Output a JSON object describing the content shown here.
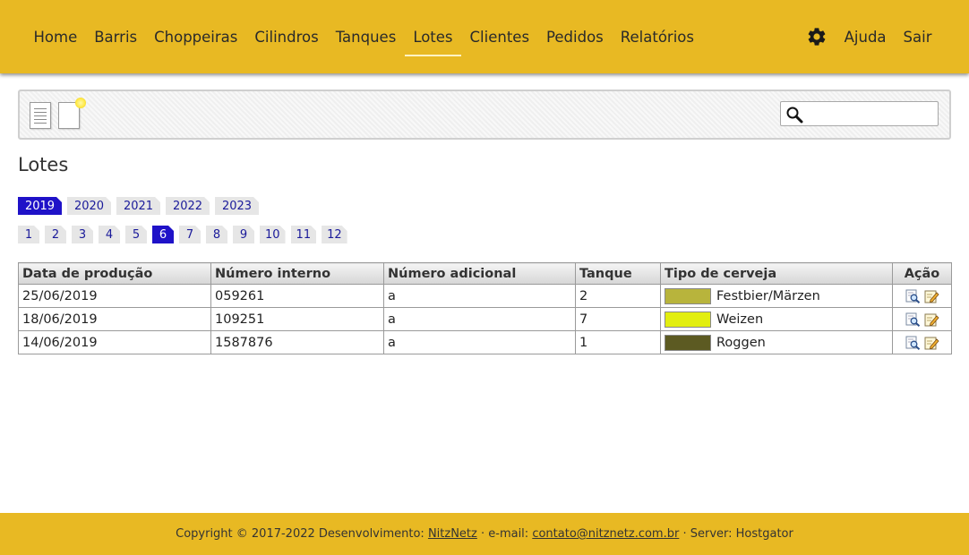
{
  "nav": {
    "items": [
      {
        "label": "Home",
        "active": false
      },
      {
        "label": "Barris",
        "active": false
      },
      {
        "label": "Choppeiras",
        "active": false
      },
      {
        "label": "Cilindros",
        "active": false
      },
      {
        "label": "Tanques",
        "active": false
      },
      {
        "label": "Lotes",
        "active": true
      },
      {
        "label": "Clientes",
        "active": false
      },
      {
        "label": "Pedidos",
        "active": false
      },
      {
        "label": "Relatórios",
        "active": false
      }
    ],
    "settings_icon": "gear-icon",
    "help_label": "Ajuda",
    "logout_label": "Sair"
  },
  "toolbar": {
    "list_icon": "list-document-icon",
    "new_icon": "new-document-icon",
    "search": {
      "value": "",
      "placeholder": "",
      "icon": "search-icon"
    }
  },
  "page": {
    "title": "Lotes"
  },
  "years": {
    "items": [
      "2019",
      "2020",
      "2021",
      "2022",
      "2023"
    ],
    "selected": "2019"
  },
  "months": {
    "items": [
      "1",
      "2",
      "3",
      "4",
      "5",
      "6",
      "7",
      "8",
      "9",
      "10",
      "11",
      "12"
    ],
    "selected": "6"
  },
  "table": {
    "headers": [
      "Data de produção",
      "Número interno",
      "Número adicional",
      "Tanque",
      "Tipo de cerveja",
      "Ação"
    ],
    "rows": [
      {
        "date": "25/06/2019",
        "internal": "059261",
        "additional": "a",
        "tank": "2",
        "beer": "Festbier/Märzen",
        "color": "#b8b43c"
      },
      {
        "date": "18/06/2019",
        "internal": "109251",
        "additional": "a",
        "tank": "7",
        "beer": "Weizen",
        "color": "#e2ee10"
      },
      {
        "date": "14/06/2019",
        "internal": "1587876",
        "additional": "a",
        "tank": "1",
        "beer": "Roggen",
        "color": "#5c5a22"
      }
    ],
    "action_icons": [
      "view-icon",
      "edit-icon"
    ]
  },
  "footer": {
    "prefix": "Copyright © 2017-2022 Desenvolvimento: ",
    "dev_link": "NitzNetz",
    "email_prefix": " · e-mail: ",
    "email": "contato@nitznetz.com.br",
    "server": " · Server: Hostgator"
  },
  "colors": {
    "header_bg": "#e8b923",
    "active_tab": "#1f12c8",
    "tab_text": "#1a1a9a"
  }
}
